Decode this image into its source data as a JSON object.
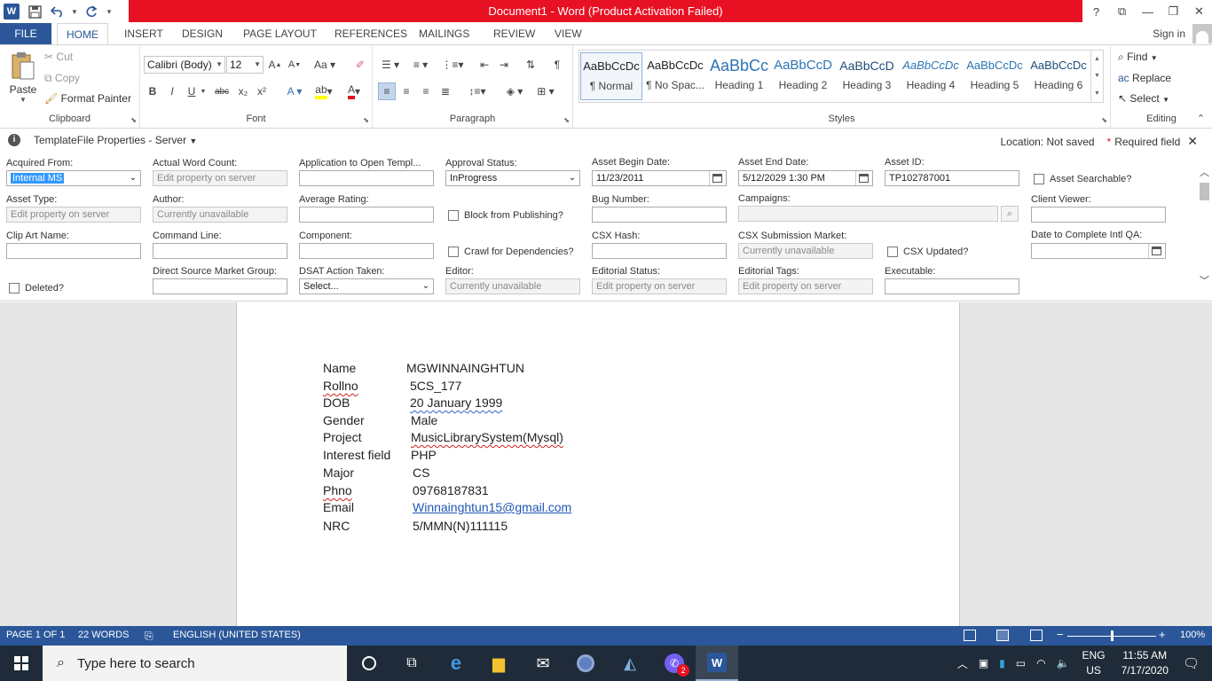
{
  "window": {
    "title": "Document1  -  Word (Product Activation Failed)",
    "title_bar_color": "#e81123",
    "controls": [
      "?",
      "⧉",
      "—",
      "❐",
      "✕"
    ]
  },
  "ribbon_tabs": {
    "file": "FILE",
    "items": [
      "HOME",
      "INSERT",
      "DESIGN",
      "PAGE LAYOUT",
      "REFERENCES",
      "MAILINGS",
      "REVIEW",
      "VIEW"
    ],
    "active": "HOME",
    "sign_in": "Sign in"
  },
  "clipboard": {
    "paste": "Paste",
    "cut": "Cut",
    "copy": "Copy",
    "format_painter": "Format Painter",
    "label": "Clipboard"
  },
  "font": {
    "name": "Calibri (Body)",
    "size": "12",
    "label": "Font",
    "bold": "B",
    "italic": "I",
    "underline": "U",
    "strike": "abc",
    "sub": "x₂",
    "sup": "x²"
  },
  "paragraph": {
    "label": "Paragraph"
  },
  "styles": {
    "label": "Styles",
    "items": [
      {
        "preview": "AaBbCcDc",
        "name": "¶ Normal"
      },
      {
        "preview": "AaBbCcDc",
        "name": "¶ No Spac..."
      },
      {
        "preview": "AaBbCc",
        "name": "Heading 1"
      },
      {
        "preview": "AaBbCcD",
        "name": "Heading 2"
      },
      {
        "preview": "AaBbCcD",
        "name": "Heading 3"
      },
      {
        "preview": "AaBbCcDc",
        "name": "Heading 4"
      },
      {
        "preview": "AaBbCcDc",
        "name": "Heading 5"
      },
      {
        "preview": "AaBbCcDc",
        "name": "Heading 6"
      }
    ]
  },
  "editing": {
    "find": "Find",
    "replace": "Replace",
    "select": "Select",
    "label": "Editing"
  },
  "properties_panel": {
    "title": "TemplateFile Properties - Server",
    "location": "Location: Not saved",
    "required": "Required field",
    "fields": {
      "acquired_from": {
        "label": "Acquired From:",
        "value": "Internal MS"
      },
      "actual_word_count": {
        "label": "Actual Word Count:",
        "value": "Edit property on server"
      },
      "app_to_open": {
        "label": "Application to Open Templ...",
        "value": ""
      },
      "approval_status": {
        "label": "Approval Status:",
        "value": "InProgress"
      },
      "asset_begin_date": {
        "label": "Asset Begin Date:",
        "value": "11/23/2011"
      },
      "asset_end_date": {
        "label": "Asset End Date:",
        "value": "5/12/2029 1:30 PM"
      },
      "asset_id": {
        "label": "Asset ID:",
        "value": "TP102787001"
      },
      "asset_searchable": {
        "label": "Asset Searchable?"
      },
      "asset_type": {
        "label": "Asset Type:",
        "value": "Edit property on server"
      },
      "author": {
        "label": "Author:",
        "value": "Currently unavailable"
      },
      "average_rating": {
        "label": "Average Rating:",
        "value": ""
      },
      "block_publishing": {
        "label": "Block from Publishing?"
      },
      "bug_number": {
        "label": "Bug Number:",
        "value": ""
      },
      "campaigns": {
        "label": "Campaigns:",
        "value": ""
      },
      "client_viewer": {
        "label": "Client Viewer:",
        "value": ""
      },
      "clip_art_name": {
        "label": "Clip Art Name:",
        "value": ""
      },
      "command_line": {
        "label": "Command Line:",
        "value": ""
      },
      "component": {
        "label": "Component:",
        "value": ""
      },
      "crawl_dependencies": {
        "label": "Crawl for Dependencies?"
      },
      "csx_hash": {
        "label": "CSX Hash:",
        "value": ""
      },
      "csx_submission_market": {
        "label": "CSX Submission Market:",
        "value": "Currently unavailable"
      },
      "csx_updated": {
        "label": "CSX Updated?"
      },
      "date_complete_intl_qa": {
        "label": "Date to Complete Intl QA:",
        "value": ""
      },
      "deleted": {
        "label": "Deleted?"
      },
      "direct_source_market_group": {
        "label": "Direct Source Market Group:",
        "value": ""
      },
      "dsat_action_taken": {
        "label": "DSAT Action Taken:",
        "value": "Select..."
      },
      "editor": {
        "label": "Editor:",
        "value": "Currently unavailable"
      },
      "editorial_status": {
        "label": "Editorial Status:",
        "value": "Edit property on server"
      },
      "editorial_tags": {
        "label": "Editorial Tags:",
        "value": "Edit property on server"
      },
      "executable": {
        "label": "Executable:",
        "value": ""
      }
    }
  },
  "document": {
    "rows": [
      {
        "label": "Name",
        "value": "MGWINNAINGHTUN"
      },
      {
        "label": "Rollno",
        "value": "5CS_177"
      },
      {
        "label": "DOB",
        "value": "20 January 1999"
      },
      {
        "label": "Gender",
        "value": "Male"
      },
      {
        "label": " Project",
        "value": "MusicLibrarySystem(Mysql)"
      },
      {
        "label": "Interest field",
        "value": "PHP"
      },
      {
        "label": "Major",
        "value": "CS"
      },
      {
        "label": "Phno",
        "value": "09768187831"
      },
      {
        "label": "Email",
        "value": "Winnainghtun15@gmail.com"
      },
      {
        "label": "NRC",
        "value": "5/MMN(N)111115"
      }
    ]
  },
  "status_bar": {
    "page": "PAGE 1 OF 1",
    "words": "22 WORDS",
    "language": "ENGLISH (UNITED STATES)",
    "zoom": "100%",
    "zoom_percent": 100,
    "color": "#2b579a"
  },
  "taskbar": {
    "search_placeholder": "Type here to search",
    "badge": "2",
    "lang_top": "ENG",
    "lang_bottom": "US",
    "time": "11:55 AM",
    "date": "7/17/2020"
  }
}
